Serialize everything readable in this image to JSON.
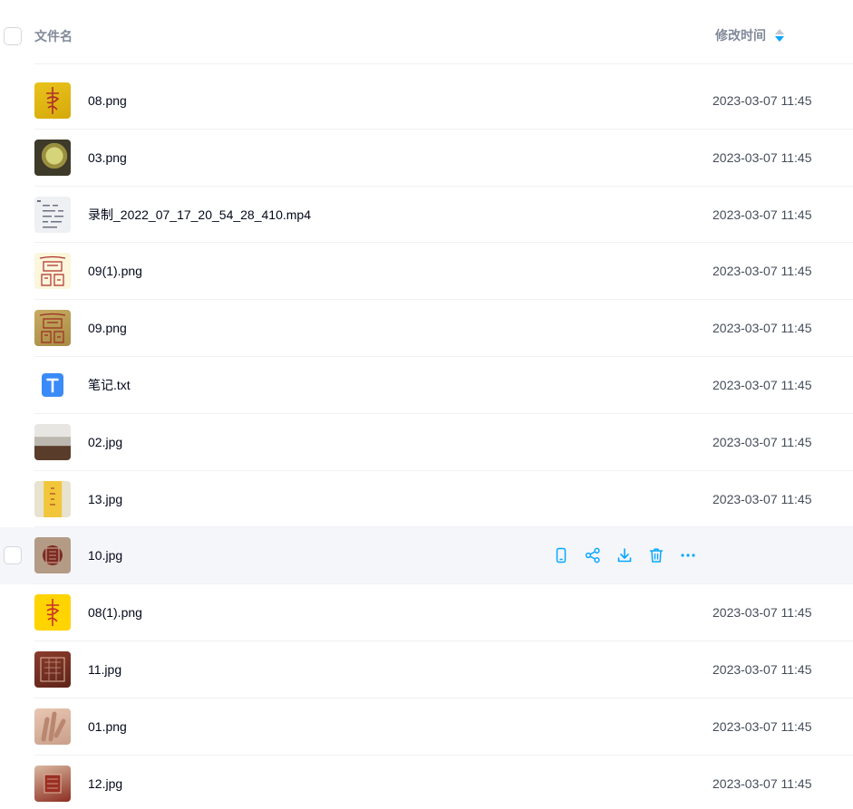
{
  "header": {
    "name_label": "文件名",
    "time_label": "修改时间"
  },
  "files": [
    {
      "name": "08.png",
      "time": "2023-03-07 11:45",
      "thumb": "yellow-seal"
    },
    {
      "name": "03.png",
      "time": "2023-03-07 11:45",
      "thumb": "fingers"
    },
    {
      "name": "录制_2022_07_17_20_54_28_410.mp4",
      "time": "2023-03-07 11:45",
      "thumb": "document"
    },
    {
      "name": "09(1).png",
      "time": "2023-03-07 11:45",
      "thumb": "paper-seal"
    },
    {
      "name": "09.png",
      "time": "2023-03-07 11:45",
      "thumb": "tan-seal"
    },
    {
      "name": "笔记.txt",
      "time": "2023-03-07 11:45",
      "thumb": "txt-icon"
    },
    {
      "name": "02.jpg",
      "time": "2023-03-07 11:45",
      "thumb": "bowl"
    },
    {
      "name": "13.jpg",
      "time": "2023-03-07 11:45",
      "thumb": "strip"
    },
    {
      "name": "10.jpg",
      "time": "",
      "thumb": "stamp",
      "hovered": true
    },
    {
      "name": "08(1).png",
      "time": "2023-03-07 11:45",
      "thumb": "yellow-seal-2"
    },
    {
      "name": "11.jpg",
      "time": "2023-03-07 11:45",
      "thumb": "red-stamp"
    },
    {
      "name": "01.png",
      "time": "2023-03-07 11:45",
      "thumb": "hand"
    },
    {
      "name": "12.jpg",
      "time": "2023-03-07 11:45",
      "thumb": "stamp-2"
    }
  ],
  "hover_actions": [
    "phone-icon",
    "share-icon",
    "download-icon",
    "delete-icon",
    "more-icon"
  ],
  "colors": {
    "accent": "#06a7ff",
    "header_text": "#818999",
    "row_hover": "#f5f6fa"
  }
}
